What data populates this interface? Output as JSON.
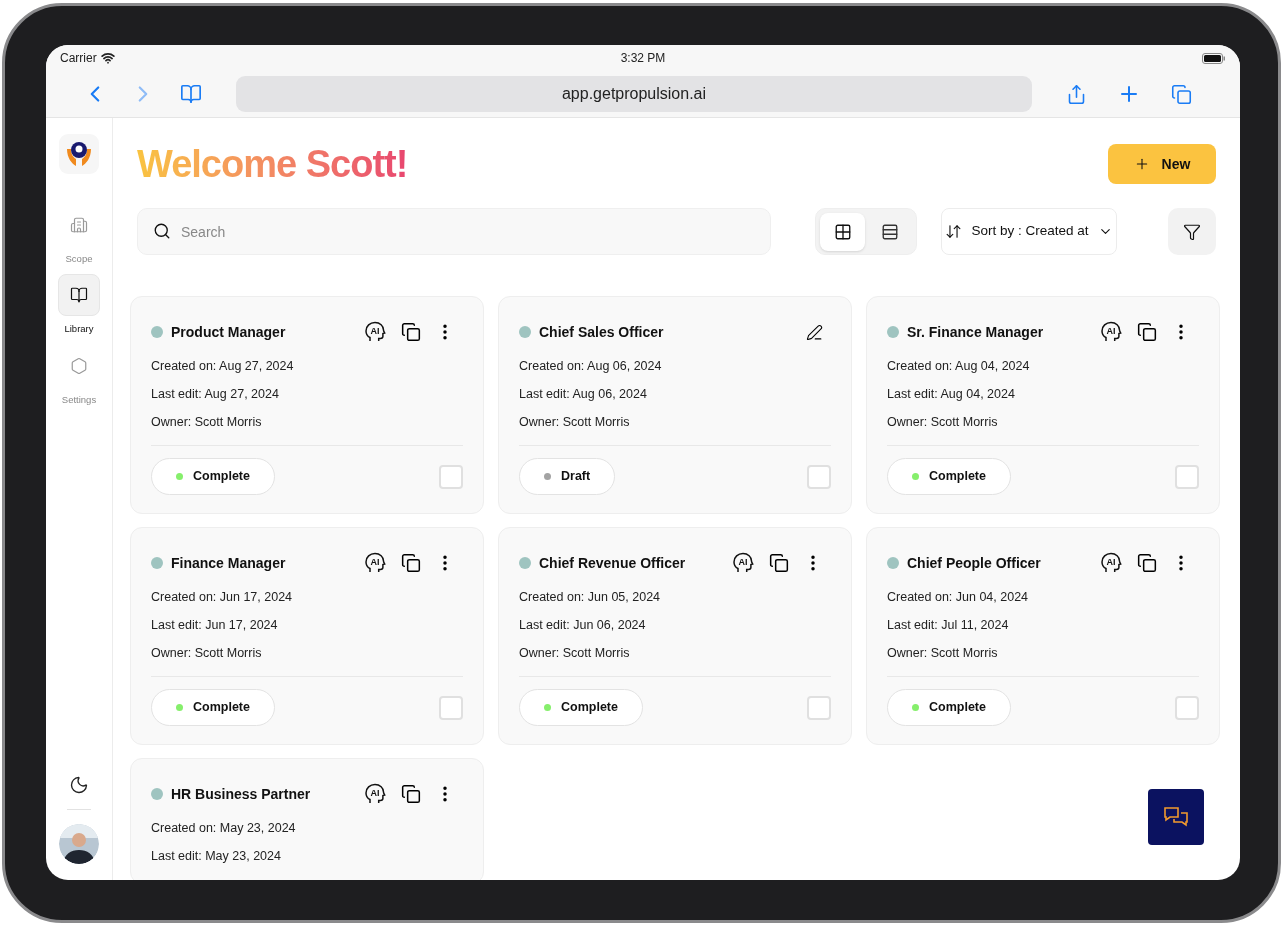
{
  "status_bar": {
    "carrier": "Carrier",
    "time": "3:32 PM"
  },
  "browser": {
    "url": "app.getpropulsion.ai"
  },
  "sidebar": {
    "items": [
      {
        "label": "Scope",
        "selected": false
      },
      {
        "label": "Library",
        "selected": true
      },
      {
        "label": "Settings",
        "selected": false
      }
    ]
  },
  "header": {
    "title": "Welcome Scott!",
    "new_button": "New"
  },
  "toolbar": {
    "search_placeholder": "Search",
    "views": [
      {
        "kind": "grid",
        "selected": true
      },
      {
        "kind": "list",
        "selected": false
      }
    ],
    "sort_label": "Sort by : Created at"
  },
  "cards": [
    {
      "title": "Product Manager",
      "actions": [
        {
          "kind": "ai",
          "label": "AI"
        },
        {
          "kind": "copy"
        },
        {
          "kind": "more"
        }
      ],
      "lines": [
        "Created on: Aug 27, 2024",
        "Last edit: Aug 27, 2024",
        "Owner: Scott Morris"
      ],
      "status": {
        "label": "Complete",
        "color": "#86ef6c"
      },
      "checked": false
    },
    {
      "title": "Chief Sales Officer",
      "actions": [
        {
          "kind": "edit"
        }
      ],
      "lines": [
        "Created on: Aug 06, 2024",
        "Last edit: Aug 06, 2024",
        "Owner: Scott Morris"
      ],
      "status": {
        "label": "Draft",
        "color": "#a3a3a3"
      },
      "checked": false
    },
    {
      "title": "Sr. Finance Manager",
      "actions": [
        {
          "kind": "ai",
          "label": "AI"
        },
        {
          "kind": "copy"
        },
        {
          "kind": "more"
        }
      ],
      "lines": [
        "Created on: Aug 04, 2024",
        "Last edit: Aug 04, 2024",
        "Owner: Scott Morris"
      ],
      "status": {
        "label": "Complete",
        "color": "#86ef6c"
      },
      "checked": false
    },
    {
      "title": "Finance Manager",
      "actions": [
        {
          "kind": "ai",
          "label": "AI"
        },
        {
          "kind": "copy"
        },
        {
          "kind": "more"
        }
      ],
      "lines": [
        "Created on: Jun 17, 2024",
        "Last edit: Jun 17, 2024",
        "Owner: Scott Morris"
      ],
      "status": {
        "label": "Complete",
        "color": "#86ef6c"
      },
      "checked": false
    },
    {
      "title": "Chief Revenue Officer",
      "actions": [
        {
          "kind": "ai",
          "label": "AI"
        },
        {
          "kind": "copy"
        },
        {
          "kind": "more"
        }
      ],
      "lines": [
        "Created on: Jun 05, 2024",
        "Last edit: Jun 06, 2024",
        "Owner: Scott Morris"
      ],
      "status": {
        "label": "Complete",
        "color": "#86ef6c"
      },
      "checked": false
    },
    {
      "title": "Chief People Officer",
      "actions": [
        {
          "kind": "ai",
          "label": "AI"
        },
        {
          "kind": "copy"
        },
        {
          "kind": "more"
        }
      ],
      "lines": [
        "Created on: Jun 04, 2024",
        "Last edit: Jul 11, 2024",
        "Owner: Scott Morris"
      ],
      "status": {
        "label": "Complete",
        "color": "#86ef6c"
      },
      "checked": false
    },
    {
      "title": "HR Business Partner",
      "actions": [
        {
          "kind": "ai",
          "label": "AI"
        },
        {
          "kind": "copy"
        },
        {
          "kind": "more"
        }
      ],
      "lines": [
        "Created on: May 23, 2024",
        "Last edit: May 23, 2024"
      ]
    }
  ]
}
